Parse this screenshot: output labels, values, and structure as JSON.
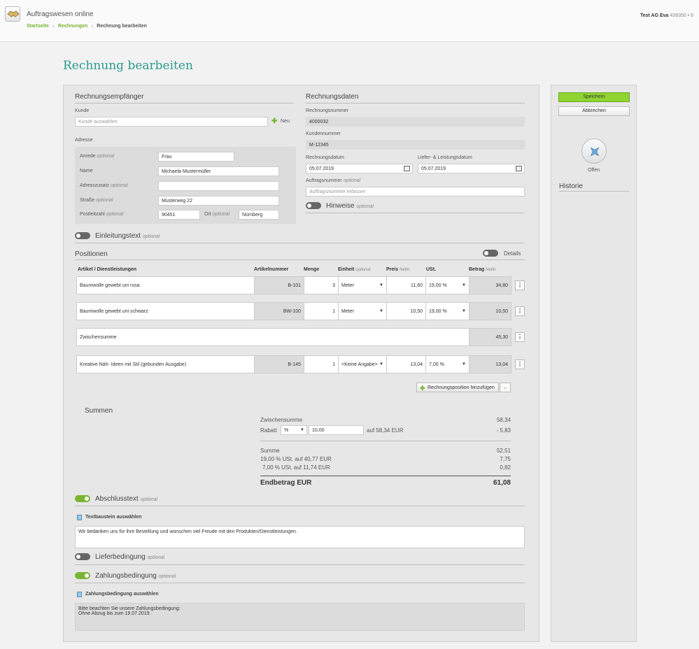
{
  "header": {
    "app_title": "Auftragswesen online",
    "breadcrumbs": [
      "Startseite",
      "Rechnungen",
      "Rechnung bearbeiten"
    ],
    "user": "Test AG Eva",
    "user_num": "439350 • 6"
  },
  "page_title": "Rechnung bearbeiten",
  "recipient": {
    "heading": "Rechnungsempfänger",
    "kunde_label": "Kunde",
    "kunde_placeholder": "Kunde auswählen",
    "new_label": "Neu",
    "adresse_label": "Adresse",
    "optional": "optional",
    "anrede_label": "Anrede",
    "anrede": "Frau",
    "name_label": "Name",
    "name": "Michaela Mustermüller",
    "zusatz_label": "Adresszusatz",
    "zusatz": "",
    "strasse_label": "Straße",
    "strasse": "Musterweg 22",
    "plz_label": "Postleitzahl",
    "plz": "90451",
    "ort_label": "Ort",
    "ort": "Nürnberg"
  },
  "invoice": {
    "heading": "Rechnungsdaten",
    "nr_label": "Rechnungsnummer",
    "nr": "4000032",
    "kdnr_label": "Kundennummer",
    "kdnr": "M-12345",
    "datum_label": "Rechnungsdatum",
    "datum": "05.07.2019",
    "liefer_label": "Liefer- & Leistungsdatum",
    "liefer": "05.07.2019",
    "auftrag_label": "Auftragsnummer",
    "auftrag_placeholder": "Auftragsnummer erfassen",
    "hinweise": "Hinweise"
  },
  "einleitung": "Einleitungstext",
  "positions": {
    "heading": "Positionen",
    "details": "Details",
    "cols": {
      "artikel": "Artikel / Dienstleistungen",
      "artnr": "Artikelnummer",
      "menge": "Menge",
      "einheit": "Einheit",
      "preis": "Preis",
      "ust": "USt.",
      "betrag": "Betrag",
      "netto": "Netto"
    },
    "rows": [
      {
        "name": "Baumwolle gewebt uni rosa",
        "artnr": "B-101",
        "menge": "3",
        "einheit": "Meter",
        "preis": "11,60",
        "ust": "19,00 %",
        "betrag": "34,80"
      },
      {
        "name": "Baumwolle gewebt uni schwarz",
        "artnr": "BW-100",
        "menge": "1",
        "einheit": "Meter",
        "preis": "10,50",
        "ust": "19,00 %",
        "betrag": "10,50"
      },
      {
        "name": "Kreative Näh- Ideen mit Stil (gebunden Ausgabe)",
        "artnr": "B-145",
        "menge": "1",
        "einheit": "<Keine Angabe>",
        "preis": "13,04",
        "ust": "7,00 %",
        "betrag": "13,04"
      }
    ],
    "zwischensumme_label": "Zwischensumme",
    "zwischensumme": "45,30",
    "add_label": "Rechnungsposition hinzufügen"
  },
  "summen": {
    "heading": "Summen",
    "zwischensumme_label": "Zwischensumme",
    "zwischensumme": "58,34",
    "rabatt_label": "Rabatt",
    "rabatt_type": "%",
    "rabatt_value": "10,00",
    "rabatt_on": "auf 58,34 EUR",
    "rabatt": "- 5,83",
    "summe_label": "Summe",
    "summe": "52,51",
    "ust19_label": "19,00 % USt. auf 40,77 EUR",
    "ust19": "7,75",
    "ust7_label": "7,00 % USt. auf 11,74 EUR",
    "ust7": "0,82",
    "end_label": "Endbetrag EUR",
    "end": "61,08"
  },
  "abschluss": {
    "label": "Abschlusstext",
    "link": "Textbaustein auswählen",
    "text": "Wir bedanken uns für ihre Bestellung und wünschen viel Freude mit den Produkten/Dienstleistungen."
  },
  "lieferbedingung": "Lieferbedingung",
  "zahlung": {
    "label": "Zahlungsbedingung",
    "link": "Zahlungsbedingung auswählen",
    "line1": "Bitte beachten Sie unsere Zahlungsbedingung:",
    "line2": "Ohne Abzug bis zum 19.07.2019."
  },
  "side": {
    "save": "Speichern",
    "cancel": "Abbrechen",
    "status": "Offen",
    "historie": "Historie"
  }
}
